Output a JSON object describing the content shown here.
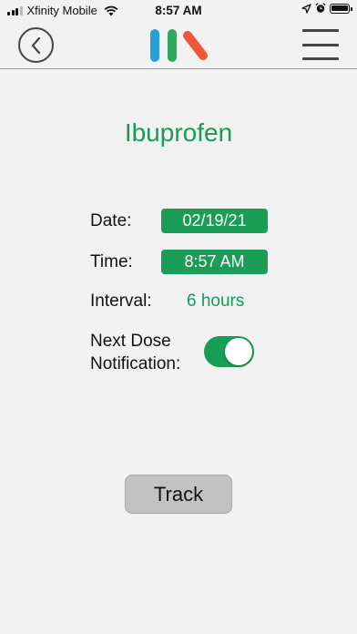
{
  "status_bar": {
    "carrier": "Xfinity Mobile",
    "time": "8:57 AM",
    "signal_bars_filled": 3,
    "signal_bars_total": 4
  },
  "nav": {
    "back_icon": "chevron-left-icon",
    "logo_colors": [
      "#2a9fd6",
      "#2eab5f",
      "#f0563a"
    ],
    "menu_icon": "hamburger-menu-icon"
  },
  "medication": {
    "name": "Ibuprofen",
    "date_label": "Date:",
    "date_value": "02/19/21",
    "time_label": "Time:",
    "time_value": "8:57 AM",
    "interval_label": "Interval:",
    "interval_value": "6 hours",
    "notification_label_line1": "Next Dose",
    "notification_label_line2": "Notification:",
    "notification_enabled": true
  },
  "actions": {
    "track_label": "Track"
  },
  "colors": {
    "accent_green": "#1a9e55",
    "background": "#f2f2f2",
    "button_gray": "#c2c2c2"
  }
}
